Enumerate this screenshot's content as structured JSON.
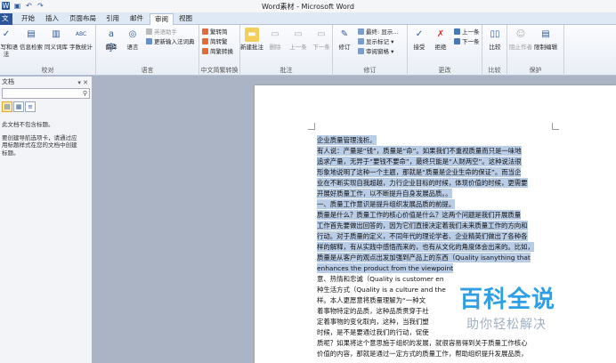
{
  "window": {
    "title": "Word素材 - Microsoft Word"
  },
  "qat": {
    "icons": [
      "word-app-icon",
      "save-icon",
      "undo-icon",
      "redo-icon"
    ]
  },
  "tabs": [
    "文件",
    "开始",
    "插入",
    "页面布局",
    "引用",
    "邮件",
    "审阅",
    "视图"
  ],
  "active_tab": "审阅",
  "ribbon": {
    "proofing": {
      "label": "校对",
      "buttons": [
        "拼写和语法",
        "信息检索",
        "同义词库",
        "字数统计"
      ]
    },
    "language": {
      "label": "语言",
      "buttons": [
        "翻译",
        "语言"
      ],
      "small": [
        "英语助手",
        "更新输入法词典"
      ]
    },
    "chinese": {
      "label": "中文简繁转换",
      "small": [
        "繁转简",
        "简转繁",
        "简繁转换"
      ]
    },
    "comments": {
      "label": "批注",
      "buttons": [
        "新建批注",
        "删除",
        "上一条",
        "下一条"
      ]
    },
    "tracking": {
      "label": "修订",
      "buttons": [
        "修订"
      ],
      "small": [
        "最终: 显示...",
        "显示标记 ▾",
        "审阅窗格 ▾"
      ]
    },
    "changes": {
      "label": "更改",
      "buttons": [
        "接受",
        "拒绝"
      ],
      "small": [
        "上一条",
        "下一条"
      ]
    },
    "compare": {
      "label": "比较",
      "buttons": [
        "比较"
      ]
    },
    "protect": {
      "label": "保护",
      "buttons": [
        "阻止作者",
        "限制编辑"
      ]
    }
  },
  "nav": {
    "title": "文档",
    "search_placeholder": "",
    "lines": [
      "此文档不包含标题。",
      "",
      "要创建导航选项卡，请通过应",
      "用标题样式在您的文档中创建",
      "标题。"
    ]
  },
  "document": {
    "lines": [
      {
        "text": "企业质量管理浅析。",
        "hl": true
      },
      {
        "text": "有人说：产量是“钱”，质量是“命”。如果我们不重视质量而只是一味地",
        "hl": true
      },
      {
        "text": "追求产量，无异于“要钱不要命”，最终只能是“人财两空”。这种说法很",
        "hl": true
      },
      {
        "text": "形象地说明了这种一个主题，那就是“质量是企业生命的保证”。而当企",
        "hl": true
      },
      {
        "text": "业在不断实现自我超越，力行企业目标的时候，体现价值的时候，更需要",
        "hl": true
      },
      {
        "text": "开展好质量工作，以不断提升自身发展品质。。",
        "hl": true
      },
      {
        "text": "一、质量工作意识是提升组织发展品质的前提。",
        "hl": true
      },
      {
        "text": "质量是什么？质量工作的核心价值是什么？这两个问题是我们开展质量",
        "hl": true
      },
      {
        "text": "工作首先要做出回答的，因为它们直接决定着我们未来质量工作的方向和",
        "hl": true
      },
      {
        "text": "行动。对于质量的定义，不同年代的理论学者、企业精英们做出了各种各",
        "hl": true
      },
      {
        "text": "样的解释，有从实践中感悟而来的，也有从文化的角度体会出来的。比如，",
        "hl": true
      },
      {
        "text": "质量是从客户的观点出发加强到产品上的东西（Quality isanything that",
        "hl": true
      },
      {
        "text": "enhances the product from the viewpoint",
        "hl": true
      },
      {
        "text": "意、热情和忠诚（Quality is customer en",
        "hl": false
      },
      {
        "text": "种生活方式（Quality is a culture and the",
        "hl": false
      },
      {
        "text": "样。本人更愿意将质量理解为“一种文",
        "hl": false
      },
      {
        "text": "着事物特定的品质，这种品质贯穿于社",
        "hl": false
      },
      {
        "text": "定着事物的变化取向，这种，当我们塑",
        "hl": false
      },
      {
        "text": "时候，是不是要通过我们的行动，促使",
        "hl": false
      },
      {
        "text": "质呢？如果将这个意思施于组织的发展，就很容易得到关于质量工作核心",
        "hl": false
      },
      {
        "text": "价值的内容，那就是通过一定方式的质量工作，帮助组织提升发展品质，",
        "hl": false
      }
    ]
  },
  "watermark": {
    "title": "百科全说",
    "subtitle": "助你轻松解决"
  }
}
